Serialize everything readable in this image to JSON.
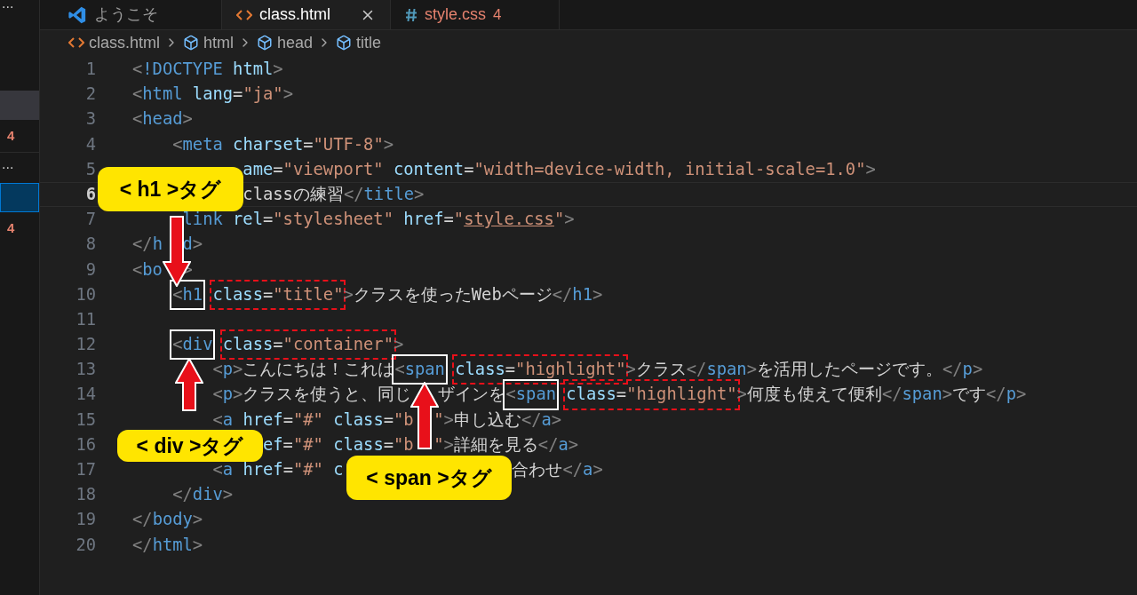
{
  "sidebar": {
    "items": [
      {
        "kind": "more",
        "text": "..."
      },
      {
        "kind": "row",
        "highlighted": true,
        "selected": false
      },
      {
        "kind": "badge",
        "text": "4"
      },
      {
        "kind": "more",
        "text": "..."
      },
      {
        "kind": "row",
        "highlighted": false,
        "selected": true
      },
      {
        "kind": "badge",
        "text": "4"
      }
    ]
  },
  "tabs": [
    {
      "kind": "welcome",
      "label": "ようこそ",
      "selected": false,
      "closable": false,
      "problems": false
    },
    {
      "kind": "html",
      "label": "class.html",
      "selected": true,
      "closable": true,
      "problems": false
    },
    {
      "kind": "css",
      "label": "style.css",
      "selected": false,
      "closable": false,
      "problems": true,
      "badge": "4"
    }
  ],
  "breadcrumb": [
    {
      "kind": "file",
      "text": "class.html"
    },
    {
      "kind": "element",
      "text": "html"
    },
    {
      "kind": "element",
      "text": "head"
    },
    {
      "kind": "element",
      "text": "title"
    }
  ],
  "lines": [
    {
      "number": "1",
      "current": false,
      "tokens": [
        {
          "kind": "p",
          "text": "<"
        },
        {
          "kind": "tag",
          "text": "!DOCTYPE"
        },
        {
          "kind": "attr",
          "text": " html"
        },
        {
          "kind": "p",
          "text": ">"
        }
      ]
    },
    {
      "number": "2",
      "current": false,
      "tokens": [
        {
          "kind": "p",
          "text": "<"
        },
        {
          "kind": "tag",
          "text": "html"
        },
        {
          "kind": "attr",
          "text": " lang"
        },
        {
          "kind": "txt",
          "text": "="
        },
        {
          "kind": "str",
          "text": "\"ja\""
        },
        {
          "kind": "p",
          "text": ">"
        }
      ]
    },
    {
      "number": "3",
      "current": false,
      "tokens": [
        {
          "kind": "p",
          "text": "<"
        },
        {
          "kind": "tag",
          "text": "head"
        },
        {
          "kind": "p",
          "text": ">"
        }
      ]
    },
    {
      "number": "4",
      "current": false,
      "tokens": [
        {
          "kind": "p",
          "text": "<"
        },
        {
          "kind": "tag",
          "text": "meta"
        },
        {
          "kind": "attr",
          "text": " charset"
        },
        {
          "kind": "txt",
          "text": "="
        },
        {
          "kind": "str",
          "text": "\"UTF-8\""
        },
        {
          "kind": "p",
          "text": ">"
        }
      ]
    },
    {
      "number": "5",
      "current": false,
      "tokens": [
        {
          "kind": "gap"
        },
        {
          "kind": "attr",
          "text": "ame"
        },
        {
          "kind": "txt",
          "text": "="
        },
        {
          "kind": "str",
          "text": "\"viewport\""
        },
        {
          "kind": "attr",
          "text": " content"
        },
        {
          "kind": "txt",
          "text": "="
        },
        {
          "kind": "str",
          "text": "\"width=device-width, initial-scale=1.0\""
        },
        {
          "kind": "p",
          "text": ">"
        }
      ]
    },
    {
      "number": "6",
      "current": true,
      "tokens": [
        {
          "kind": "gap"
        },
        {
          "kind": "txt",
          "text": "classの練習"
        },
        {
          "kind": "p",
          "text": "</"
        },
        {
          "kind": "tag",
          "text": "title"
        },
        {
          "kind": "p",
          "text": ">"
        }
      ]
    },
    {
      "number": "7",
      "current": false,
      "tokens": [
        {
          "kind": "gap"
        },
        {
          "kind": "tag",
          "text": "link"
        },
        {
          "kind": "attr",
          "text": " rel"
        },
        {
          "kind": "txt",
          "text": "="
        },
        {
          "kind": "str",
          "text": "\"stylesheet\""
        },
        {
          "kind": "attr",
          "text": " href"
        },
        {
          "kind": "txt",
          "text": "="
        },
        {
          "kind": "str",
          "text": "\""
        },
        {
          "kind": "link",
          "text": "style.css"
        },
        {
          "kind": "str",
          "text": "\""
        },
        {
          "kind": "p",
          "text": ">"
        }
      ]
    },
    {
      "number": "8",
      "current": false,
      "tokens": [
        {
          "kind": "p",
          "text": "</"
        },
        {
          "kind": "tag",
          "text": "h"
        },
        {
          "kind": "gap"
        },
        {
          "kind": "tag",
          "text": "d"
        },
        {
          "kind": "p",
          "text": ">"
        }
      ]
    },
    {
      "number": "9",
      "current": false,
      "tokens": [
        {
          "kind": "p",
          "text": "<"
        },
        {
          "kind": "tag",
          "text": "bo"
        },
        {
          "kind": "gap"
        },
        {
          "kind": "p",
          "text": ">"
        }
      ]
    },
    {
      "number": "10",
      "current": false,
      "tokens": [
        {
          "kind": "solid-box",
          "tokens": [
            {
              "kind": "p",
              "text": "<"
            },
            {
              "kind": "tag",
              "text": "h1"
            }
          ]
        },
        {
          "kind": "dashed-box",
          "tokens": [
            {
              "kind": "attr",
              "text": "class"
            },
            {
              "kind": "txt",
              "text": "="
            },
            {
              "kind": "str",
              "text": "\"title\""
            }
          ]
        },
        {
          "kind": "p",
          "text": ">"
        },
        {
          "kind": "txt",
          "text": "クラスを使ったWebページ"
        },
        {
          "kind": "p",
          "text": "</"
        },
        {
          "kind": "tag",
          "text": "h1"
        },
        {
          "kind": "p",
          "text": ">"
        }
      ]
    },
    {
      "number": "11",
      "current": false
    },
    {
      "number": "12",
      "current": false,
      "tokens": [
        {
          "kind": "solid-box",
          "tokens": [
            {
              "kind": "p",
              "text": "<"
            },
            {
              "kind": "tag",
              "text": "div"
            }
          ]
        },
        {
          "kind": "dashed-box",
          "tokens": [
            {
              "kind": "attr",
              "text": "class"
            },
            {
              "kind": "txt",
              "text": "="
            },
            {
              "kind": "str",
              "text": "\"container\""
            }
          ]
        },
        {
          "kind": "p",
          "text": ">"
        }
      ]
    },
    {
      "number": "13",
      "current": false,
      "tokens": [
        {
          "kind": "p",
          "text": "<"
        },
        {
          "kind": "tag",
          "text": "p"
        },
        {
          "kind": "p",
          "text": ">"
        },
        {
          "kind": "txt",
          "text": "こんにちは！これは"
        },
        {
          "kind": "solid-box",
          "tokens": [
            {
              "kind": "p",
              "text": "<"
            },
            {
              "kind": "tag",
              "text": "span"
            }
          ]
        },
        {
          "kind": "dashed-box",
          "tokens": [
            {
              "kind": "attr",
              "text": "class"
            },
            {
              "kind": "txt",
              "text": "="
            },
            {
              "kind": "str",
              "text": "\"highlight\""
            }
          ]
        },
        {
          "kind": "p",
          "text": ">"
        },
        {
          "kind": "txt",
          "text": "クラス"
        },
        {
          "kind": "p",
          "text": "</"
        },
        {
          "kind": "tag",
          "text": "span"
        },
        {
          "kind": "p",
          "text": ">"
        },
        {
          "kind": "txt",
          "text": "を活用したページです。"
        },
        {
          "kind": "p",
          "text": "</"
        },
        {
          "kind": "tag",
          "text": "p"
        },
        {
          "kind": "p",
          "text": ">"
        }
      ]
    },
    {
      "number": "14",
      "current": false,
      "tokens": [
        {
          "kind": "p",
          "text": "<"
        },
        {
          "kind": "tag",
          "text": "p"
        },
        {
          "kind": "p",
          "text": ">"
        },
        {
          "kind": "txt",
          "text": "クラスを使うと、同じ"
        },
        {
          "kind": "gap"
        },
        {
          "kind": "txt",
          "text": "ザインを"
        },
        {
          "kind": "solid-box",
          "tokens": [
            {
              "kind": "p",
              "text": "<"
            },
            {
              "kind": "tag",
              "text": "span"
            }
          ]
        },
        {
          "kind": "dashed-box",
          "tokens": [
            {
              "kind": "attr",
              "text": "class"
            },
            {
              "kind": "txt",
              "text": "="
            },
            {
              "kind": "str",
              "text": "\"highlight\""
            }
          ]
        },
        {
          "kind": "p",
          "text": ">"
        },
        {
          "kind": "txt",
          "text": "何度も使えて便利"
        },
        {
          "kind": "p",
          "text": "</"
        },
        {
          "kind": "tag",
          "text": "span"
        },
        {
          "kind": "p",
          "text": ">"
        },
        {
          "kind": "txt",
          "text": "です"
        },
        {
          "kind": "p",
          "text": "</"
        },
        {
          "kind": "tag",
          "text": "p"
        },
        {
          "kind": "p",
          "text": ">"
        }
      ]
    },
    {
      "number": "15",
      "current": false,
      "tokens": [
        {
          "kind": "p",
          "text": "<"
        },
        {
          "kind": "tag",
          "text": "a"
        },
        {
          "kind": "attr",
          "text": " href"
        },
        {
          "kind": "txt",
          "text": "="
        },
        {
          "kind": "str",
          "text": "\"#\""
        },
        {
          "kind": "attr",
          "text": " class"
        },
        {
          "kind": "txt",
          "text": "="
        },
        {
          "kind": "str",
          "text": "\"b"
        },
        {
          "kind": "gap"
        },
        {
          "kind": "str",
          "text": "\""
        },
        {
          "kind": "p",
          "text": ">"
        },
        {
          "kind": "txt",
          "text": "申し込む"
        },
        {
          "kind": "p",
          "text": "</"
        },
        {
          "kind": "tag",
          "text": "a"
        },
        {
          "kind": "p",
          "text": ">"
        }
      ]
    },
    {
      "number": "16",
      "current": false,
      "tokens": [
        {
          "kind": "gap"
        },
        {
          "kind": "attr",
          "text": "ef"
        },
        {
          "kind": "txt",
          "text": "="
        },
        {
          "kind": "str",
          "text": "\"#\""
        },
        {
          "kind": "attr",
          "text": " class"
        },
        {
          "kind": "txt",
          "text": "="
        },
        {
          "kind": "str",
          "text": "\"b"
        },
        {
          "kind": "gap"
        },
        {
          "kind": "str",
          "text": "\""
        },
        {
          "kind": "p",
          "text": ">"
        },
        {
          "kind": "txt",
          "text": "詳細を見る"
        },
        {
          "kind": "p",
          "text": "</"
        },
        {
          "kind": "tag",
          "text": "a"
        },
        {
          "kind": "p",
          "text": ">"
        }
      ]
    },
    {
      "number": "17",
      "current": false,
      "tokens": [
        {
          "kind": "p",
          "text": "<"
        },
        {
          "kind": "tag",
          "text": "a"
        },
        {
          "kind": "attr",
          "text": " href"
        },
        {
          "kind": "txt",
          "text": "="
        },
        {
          "kind": "str",
          "text": "\"#\""
        },
        {
          "kind": "attr",
          "text": " c"
        },
        {
          "kind": "gap"
        },
        {
          "kind": "txt",
          "text": "合わせ"
        },
        {
          "kind": "p",
          "text": "</"
        },
        {
          "kind": "tag",
          "text": "a"
        },
        {
          "kind": "p",
          "text": ">"
        }
      ]
    },
    {
      "number": "18",
      "current": false,
      "tokens": [
        {
          "kind": "p",
          "text": "</"
        },
        {
          "kind": "tag",
          "text": "div"
        },
        {
          "kind": "p",
          "text": ">"
        }
      ]
    },
    {
      "number": "19",
      "current": false,
      "tokens": [
        {
          "kind": "p",
          "text": "</"
        },
        {
          "kind": "tag",
          "text": "body"
        },
        {
          "kind": "p",
          "text": ">"
        }
      ]
    },
    {
      "number": "20",
      "current": false,
      "tokens": [
        {
          "kind": "p",
          "text": "</"
        },
        {
          "kind": "tag",
          "text": "html"
        },
        {
          "kind": "p",
          "text": ">"
        }
      ]
    }
  ],
  "annotations": [
    {
      "text": "< h1 >タグ"
    },
    {
      "text": "< div >タグ"
    },
    {
      "text": "< span >タグ"
    }
  ]
}
